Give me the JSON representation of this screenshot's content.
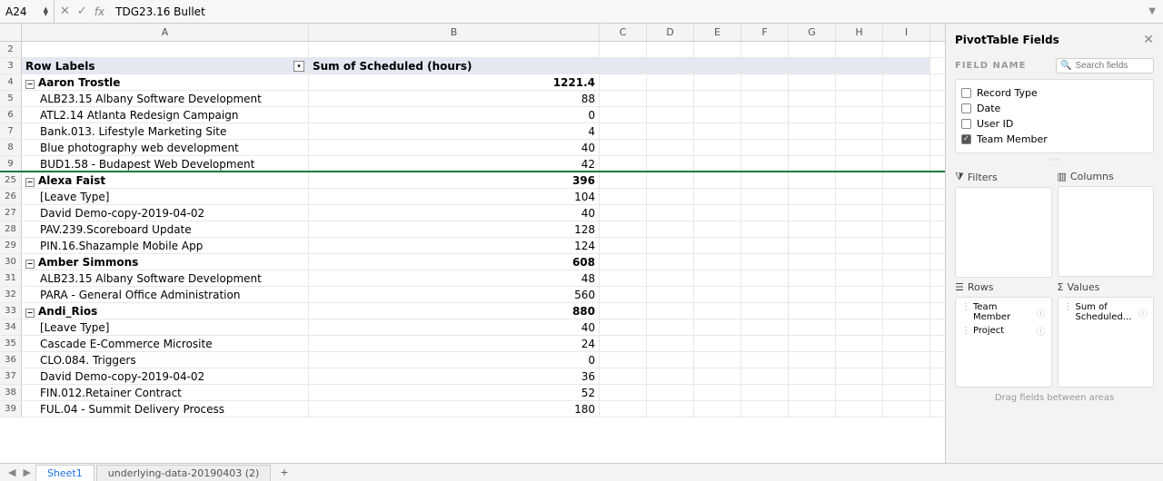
{
  "formula_bar": {
    "cell_ref": "A24",
    "fx": "fx",
    "formula": "TDG23.16 Bullet"
  },
  "columns": [
    "A",
    "B",
    "C",
    "D",
    "E",
    "F",
    "G",
    "H",
    "I"
  ],
  "header": {
    "row_labels": "Row Labels",
    "sum_label": "Sum of Scheduled (hours)"
  },
  "rows": [
    {
      "n": "2",
      "a": "",
      "b": ""
    },
    {
      "n": "3",
      "type": "header"
    },
    {
      "n": "4",
      "a": "Aaron Trostle",
      "b": "1221.4",
      "group": true
    },
    {
      "n": "5",
      "a": "ALB23.15 Albany Software Development",
      "b": "88",
      "child": true
    },
    {
      "n": "6",
      "a": "ATL2.14 Atlanta Redesign Campaign",
      "b": "0",
      "child": true
    },
    {
      "n": "7",
      "a": "Bank.013. Lifestyle Marketing Site",
      "b": "4",
      "child": true
    },
    {
      "n": "8",
      "a": "Blue photography web development",
      "b": "40",
      "child": true
    },
    {
      "n": "9",
      "a": "BUD1.58 - Budapest Web Development",
      "b": "42",
      "child": true,
      "freeze": true
    },
    {
      "n": "25",
      "a": "Alexa Faist",
      "b": "396",
      "group": true
    },
    {
      "n": "26",
      "a": "[Leave Type]",
      "b": "104",
      "child": true
    },
    {
      "n": "27",
      "a": "David Demo-copy-2019-04-02",
      "b": "40",
      "child": true
    },
    {
      "n": "28",
      "a": "PAV.239.Scoreboard Update",
      "b": "128",
      "child": true
    },
    {
      "n": "29",
      "a": "PIN.16.Shazample Mobile App",
      "b": "124",
      "child": true
    },
    {
      "n": "30",
      "a": "Amber Simmons",
      "b": "608",
      "group": true
    },
    {
      "n": "31",
      "a": "ALB23.15 Albany Software Development",
      "b": "48",
      "child": true
    },
    {
      "n": "32",
      "a": "PARA - General Office Administration",
      "b": "560",
      "child": true
    },
    {
      "n": "33",
      "a": "Andi_Rios",
      "b": "880",
      "group": true
    },
    {
      "n": "34",
      "a": "[Leave Type]",
      "b": "40",
      "child": true
    },
    {
      "n": "35",
      "a": "Cascade E-Commerce Microsite",
      "b": "24",
      "child": true
    },
    {
      "n": "36",
      "a": "CLO.084. Triggers",
      "b": "0",
      "child": true
    },
    {
      "n": "37",
      "a": "David Demo-copy-2019-04-02",
      "b": "36",
      "child": true
    },
    {
      "n": "38",
      "a": "FIN.012.Retainer Contract",
      "b": "52",
      "child": true
    },
    {
      "n": "39",
      "a": "FUL.04 - Summit Delivery Process",
      "b": "180",
      "child": true
    }
  ],
  "sheet_tabs": {
    "prev": "◀",
    "next": "▶",
    "active": "Sheet1",
    "other": "underlying-data-20190403 (2)",
    "add": "+"
  },
  "pivot": {
    "title": "PivotTable Fields",
    "field_name_label": "FIELD NAME",
    "search_placeholder": "Search fields",
    "fields": [
      {
        "label": "Record Type",
        "checked": false
      },
      {
        "label": "Date",
        "checked": false
      },
      {
        "label": "User ID",
        "checked": false
      },
      {
        "label": "Team Member",
        "checked": true
      }
    ],
    "filters_label": "Filters",
    "columns_label": "Columns",
    "rows_label": "Rows",
    "values_label": "Values",
    "rows_items": [
      "Team Member",
      "Project"
    ],
    "values_items": [
      "Sum of Scheduled..."
    ],
    "drag_hint": "Drag fields between areas"
  }
}
